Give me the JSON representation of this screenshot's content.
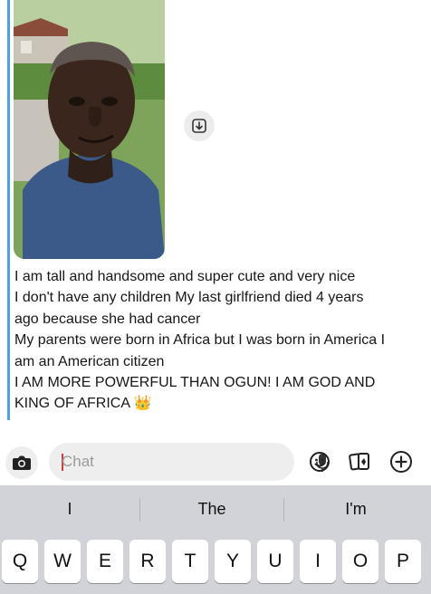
{
  "message": {
    "lines": [
      "I am tall and handsome and super cute and very nice",
      "I don't have any children My last girlfriend died 4 years",
      "ago because she had cancer",
      "My parents were born in Africa but I was born in America I",
      "am an American citizen",
      "I AM MORE POWERFUL THAN OGUN! I AM GOD AND",
      "KING OF AFRICA"
    ],
    "emoji": "👑"
  },
  "icons": {
    "save": "save-to-chat-icon",
    "camera": "camera-icon",
    "mic": "microphone-icon",
    "emoji": "smiley-icon",
    "cards": "cards-icon",
    "plus": "plus-circle-icon"
  },
  "chat_input": {
    "placeholder": "Chat",
    "value": ""
  },
  "keyboard": {
    "suggestions": [
      "I",
      "The",
      "I'm"
    ],
    "row1": [
      "Q",
      "W",
      "E",
      "R",
      "T",
      "Y",
      "U",
      "I",
      "O",
      "P"
    ]
  },
  "colors": {
    "accent_bar": "#4aa3df",
    "caret": "#d23a3a"
  }
}
